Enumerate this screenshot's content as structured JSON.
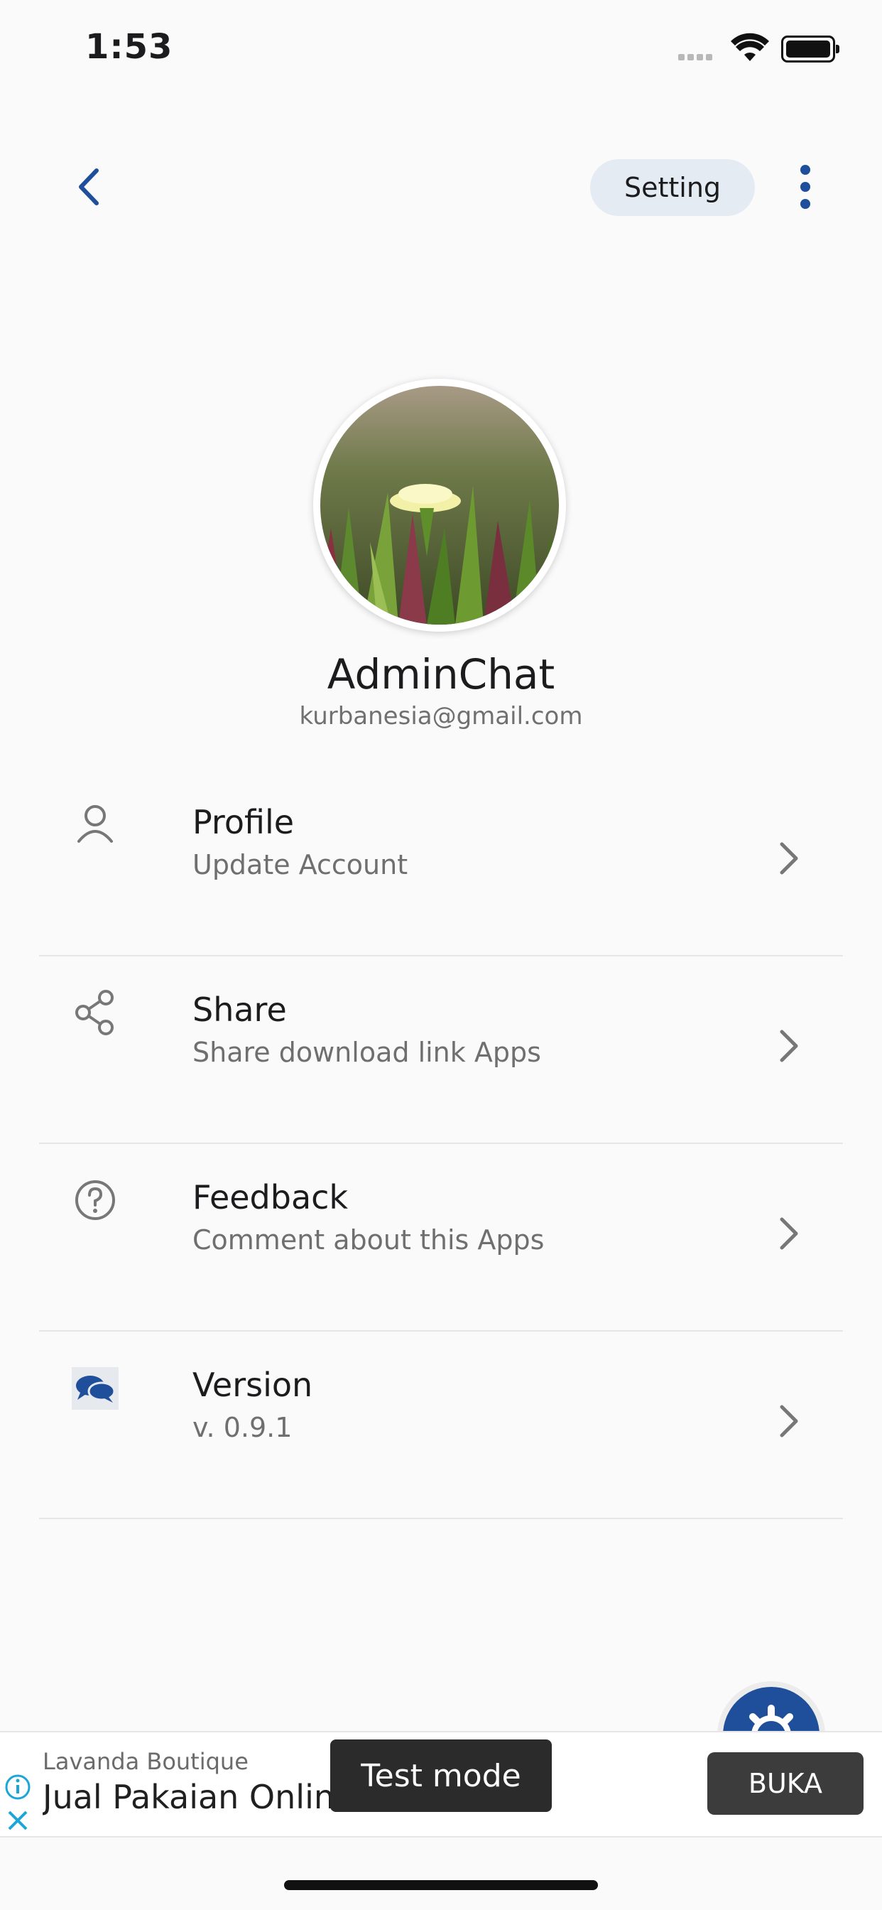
{
  "status_bar": {
    "time": "1:53"
  },
  "header": {
    "chip_label": "Setting"
  },
  "profile": {
    "name": "AdminChat",
    "email": "kurbanesia@gmail.com"
  },
  "menu": [
    {
      "title": "Profile",
      "subtitle": "Update Account",
      "icon": "person-icon"
    },
    {
      "title": "Share",
      "subtitle": "Share download link Apps",
      "icon": "share-icon"
    },
    {
      "title": "Feedback",
      "subtitle": "Comment about this Apps",
      "icon": "help-circle-icon"
    },
    {
      "title": "Version",
      "subtitle": "v. 0.9.1",
      "icon": "chat-logo-icon"
    }
  ],
  "ad": {
    "brand": "Lavanda Boutique",
    "headline": "Jual Pakaian Online",
    "test_mode": "Test mode",
    "cta": "BUKA"
  },
  "colors": {
    "accent": "#1f4e9b",
    "chip_bg": "#e5ebf2",
    "background": "#fafafa"
  }
}
